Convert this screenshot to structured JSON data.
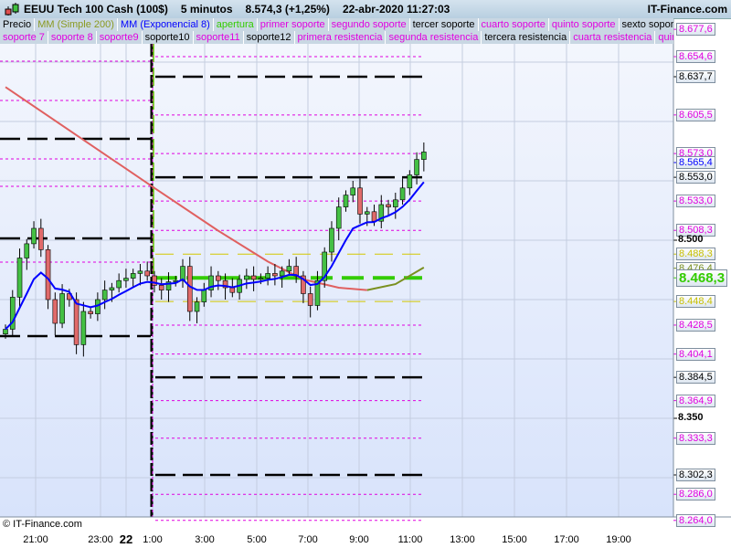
{
  "header": {
    "title": "EEUU Tech 100 Cash (100$)",
    "timeframe": "5 minutos",
    "quote": "8.574,3 (+1,25%)",
    "datetime": "22-abr-2020 11:27:03",
    "site": "IT-Finance.com"
  },
  "legend_row1": [
    {
      "label": "Precio",
      "color": "#000000"
    },
    {
      "label": "MM (Simple 200)",
      "color": "#8a9a20"
    },
    {
      "label": "MM (Exponencial 8)",
      "color": "#0000ff"
    },
    {
      "label": "apertura",
      "color": "#33cc00"
    },
    {
      "label": "primer soporte",
      "color": "#e000e0"
    },
    {
      "label": "segundo soporte",
      "color": "#e000e0"
    },
    {
      "label": "tercer soporte",
      "color": "#000000"
    },
    {
      "label": "cuarto soporte",
      "color": "#e000e0"
    },
    {
      "label": "quinto soporte",
      "color": "#e000e0"
    },
    {
      "label": "sexto soporte",
      "color": "#000000"
    }
  ],
  "legend_row2": [
    {
      "label": "soporte 7",
      "color": "#e000e0"
    },
    {
      "label": "soporte 8",
      "color": "#e000e0"
    },
    {
      "label": "soporte9",
      "color": "#e000e0"
    },
    {
      "label": "soporte10",
      "color": "#000000"
    },
    {
      "label": "soporte11",
      "color": "#e000e0"
    },
    {
      "label": "soporte12",
      "color": "#000000"
    },
    {
      "label": "primera resistencia",
      "color": "#e000e0"
    },
    {
      "label": "segunda resistencia",
      "color": "#e000e0"
    },
    {
      "label": "tercera resistencia",
      "color": "#000000"
    },
    {
      "label": "cuarta resistencia",
      "color": "#e000e0"
    },
    {
      "label": "quinta resistencia",
      "color": "#e000e0"
    }
  ],
  "copyright": "© IT-Finance.com",
  "chart_data": {
    "type": "candlestick",
    "title": "EEUU Tech 100 Cash (100$) 5 minutos",
    "ylim": [
      8250,
      8690
    ],
    "x_ticks": [
      "21:00",
      "23:00",
      "22",
      "1:00",
      "3:00",
      "5:00",
      "7:00",
      "9:00",
      "11:00",
      "13:00",
      "15:00",
      "17:00",
      "19:00"
    ],
    "closes": [
      8425,
      8452,
      8485,
      8497,
      8510,
      8492,
      8450,
      8430,
      8455,
      8450,
      8412,
      8440,
      8438,
      8450,
      8458,
      8460,
      8466,
      8468,
      8472,
      8474,
      8470,
      8462,
      8458,
      8465,
      8466,
      8478,
      8440,
      8448,
      8458,
      8470,
      8466,
      8460,
      8456,
      8467,
      8470,
      8467,
      8468,
      8472,
      8470,
      8474,
      8478,
      8470,
      8455,
      8445,
      8466,
      8490,
      8510,
      8528,
      8538,
      8544,
      8522,
      8524,
      8516,
      8530,
      8528,
      8534,
      8544,
      8555,
      8568,
      8574.3
    ],
    "sma200": [
      {
        "name": "falling",
        "color": "#e06060",
        "points": [
          [
            0,
            8629
          ],
          [
            21,
            8544
          ],
          [
            30,
            8508
          ],
          [
            37,
            8482
          ],
          [
            42,
            8467
          ],
          [
            47,
            8460
          ],
          [
            51,
            8458
          ]
        ]
      },
      {
        "name": "rising",
        "color": "#7a9020",
        "points": [
          [
            51,
            8458
          ],
          [
            55,
            8463
          ],
          [
            59,
            8477
          ]
        ]
      }
    ],
    "ema_period": 8,
    "ema_color": "#0000ff",
    "prev_day_levels": [
      {
        "price": 8650.8,
        "color": "#e000e0",
        "style": "dot"
      },
      {
        "price": 8617.7,
        "color": "#e000e0",
        "style": "dot"
      },
      {
        "price": 8585.4,
        "color": "#000000",
        "style": "dash"
      },
      {
        "price": 8568.5,
        "color": "#e000e0",
        "style": "dot"
      },
      {
        "price": 8545.4,
        "color": "#e000e0",
        "style": "dot"
      },
      {
        "price": 8501.5,
        "color": "#000000",
        "style": "dash"
      },
      {
        "price": 8481.5,
        "color": "#e000e0",
        "style": "dot"
      },
      {
        "price": 8419.2,
        "color": "#000000",
        "style": "dash"
      }
    ],
    "levels": [
      {
        "price": 8654.6,
        "color": "#e000e0",
        "style": "dot"
      },
      {
        "price": 8637.7,
        "color": "#000000",
        "style": "dash"
      },
      {
        "price": 8605.5,
        "color": "#e000e0",
        "style": "dot"
      },
      {
        "price": 8573.0,
        "color": "#e000e0",
        "style": "dot"
      },
      {
        "price": 8553.0,
        "color": "#000000",
        "style": "dash"
      },
      {
        "price": 8533.0,
        "color": "#e000e0",
        "style": "dot"
      },
      {
        "price": 8508.3,
        "color": "#e000e0",
        "style": "dot"
      },
      {
        "price": 8488.3,
        "color": "#d4c800",
        "style": "thin"
      },
      {
        "price": 8468.3,
        "color": "#33cc00",
        "style": "thick"
      },
      {
        "price": 8448.4,
        "color": "#d4c800",
        "style": "thin"
      },
      {
        "price": 8428.5,
        "color": "#e000e0",
        "style": "dot"
      },
      {
        "price": 8404.1,
        "color": "#e000e0",
        "style": "dot"
      },
      {
        "price": 8384.5,
        "color": "#000000",
        "style": "dash"
      },
      {
        "price": 8364.9,
        "color": "#e000e0",
        "style": "dot"
      },
      {
        "price": 8333.3,
        "color": "#e000e0",
        "style": "dot"
      },
      {
        "price": 8302.3,
        "color": "#000000",
        "style": "dash"
      },
      {
        "price": 8286.0,
        "color": "#e000e0",
        "style": "dot"
      },
      {
        "price": 8264.0,
        "color": "#e000e0",
        "style": "dot"
      }
    ],
    "axis_labels": [
      {
        "price": 8677.6,
        "text": "8.677,6",
        "color": "#e000e0"
      },
      {
        "price": 8654.6,
        "text": "8.654,6",
        "color": "#e000e0"
      },
      {
        "price": 8637.7,
        "text": "8.637,7",
        "color": "#000000"
      },
      {
        "price": 8605.5,
        "text": "8.605,5",
        "color": "#e000e0"
      },
      {
        "price": 8573.0,
        "text": "8.573,0",
        "color": "#e000e0"
      },
      {
        "price": 8565.4,
        "text": "8.565,4",
        "color": "#0000ff"
      },
      {
        "price": 8553.0,
        "text": "8.553,0",
        "color": "#000000"
      },
      {
        "price": 8533.0,
        "text": "8.533,0",
        "color": "#e000e0"
      },
      {
        "price": 8508.3,
        "text": "8.508,3",
        "color": "#e000e0"
      },
      {
        "price": 8500,
        "text": "8.500",
        "color": "#000000",
        "plain": true
      },
      {
        "price": 8488.3,
        "text": "8.488,3",
        "color": "#c8c000"
      },
      {
        "price": 8476.4,
        "text": "8.476,4",
        "color": "#7a9020"
      },
      {
        "price": 8468.3,
        "text": "8.468,3",
        "color": "#33cc00",
        "big": true
      },
      {
        "price": 8448.4,
        "text": "8.448,4",
        "color": "#c8c000"
      },
      {
        "price": 8428.5,
        "text": "8.428,5",
        "color": "#e000e0"
      },
      {
        "price": 8404.1,
        "text": "8.404,1",
        "color": "#e000e0"
      },
      {
        "price": 8384.5,
        "text": "8.384,5",
        "color": "#000000"
      },
      {
        "price": 8364.9,
        "text": "8.364,9",
        "color": "#e000e0"
      },
      {
        "price": 8350,
        "text": "8.350",
        "color": "#000000",
        "plain": true
      },
      {
        "price": 8333.3,
        "text": "8.333,3",
        "color": "#e000e0"
      },
      {
        "price": 8302.3,
        "text": "8.302,3",
        "color": "#000000"
      },
      {
        "price": 8286.0,
        "text": "8.286,0",
        "color": "#e000e0"
      },
      {
        "price": 8264.0,
        "text": "8.264,0",
        "color": "#e000e0"
      }
    ]
  }
}
